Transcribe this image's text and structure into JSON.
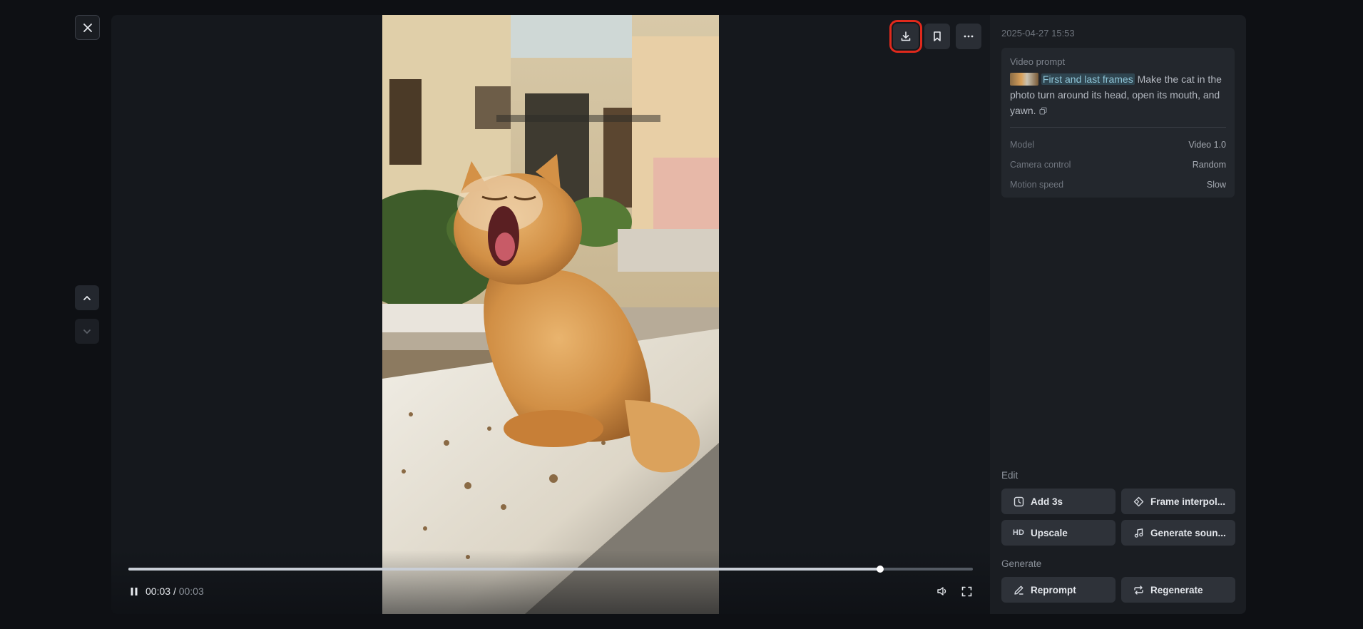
{
  "viewer": {
    "time_current": "00:03",
    "time_separator": "/",
    "time_duration": "00:03",
    "progress": 0.89,
    "actions": [
      {
        "name": "download-button",
        "icon": "download-icon",
        "highlighted": true
      },
      {
        "name": "bookmark-button",
        "icon": "bookmark-icon"
      },
      {
        "name": "more-button",
        "icon": "more-icon"
      }
    ]
  },
  "panel": {
    "timestamp": "2025-04-27 15:53",
    "prompt_label": "Video prompt",
    "prompt_tag": "First and last frames",
    "prompt_text": " Make the cat in the photo turn around its head, open its mouth, and yawn.",
    "meta": [
      {
        "key": "Model",
        "value": "Video 1.0"
      },
      {
        "key": "Camera control",
        "value": "Random"
      },
      {
        "key": "Motion speed",
        "value": "Slow"
      }
    ],
    "edit_label": "Edit",
    "edit_buttons": {
      "add": "Add 3s",
      "frame_interp": "Frame interpol...",
      "upscale": "Upscale",
      "upscale_icon_text": "HD",
      "sound": "Generate soun..."
    },
    "generate_label": "Generate",
    "generate_buttons": {
      "reprompt": "Reprompt",
      "regenerate": "Regenerate"
    }
  },
  "colors": {
    "accent_highlight": "#e0291c",
    "tag_bg": "#2f4550",
    "tag_text": "#8ec4d6"
  }
}
